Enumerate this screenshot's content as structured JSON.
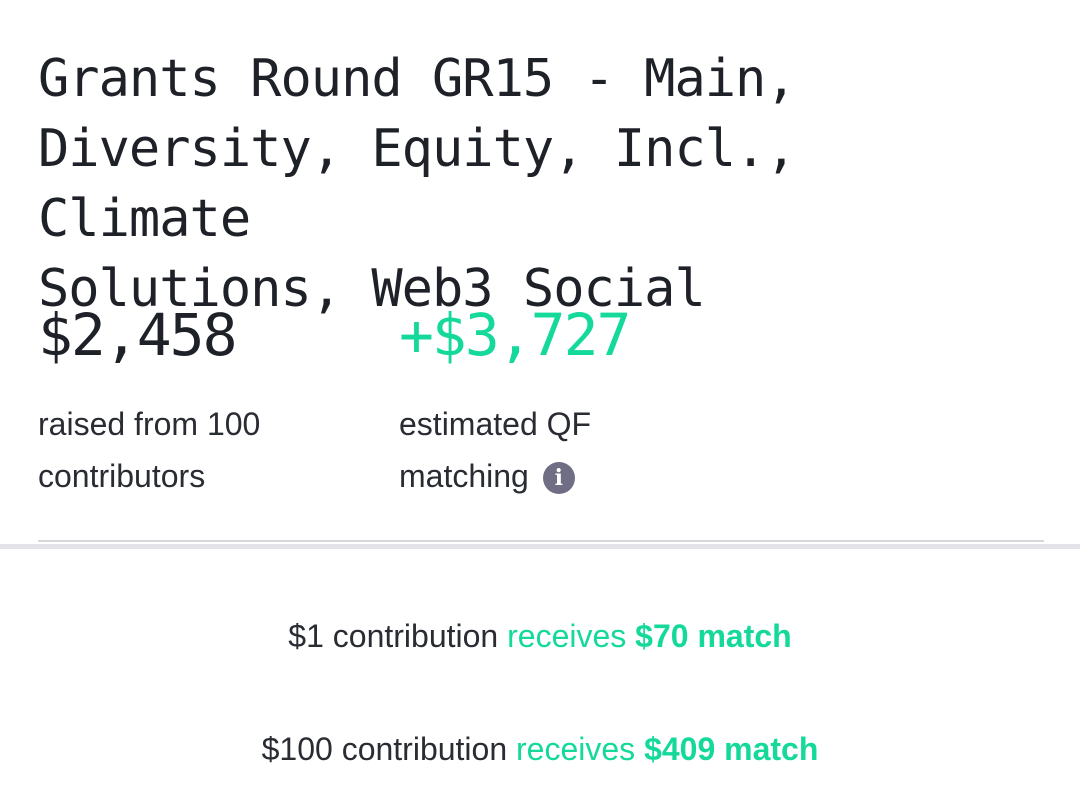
{
  "round": {
    "title_lines": [
      "Grants Round GR15 - Main,",
      "Diversity, Equity, Incl., Climate",
      "Solutions, Web3 Social"
    ]
  },
  "stats": {
    "raised_amount": "$2,458",
    "raised_caption_line1": "raised from 100",
    "raised_caption_line2": "contributors",
    "match_amount": "+$3,727",
    "match_caption_line1": "estimated QF",
    "match_caption_line2": "matching",
    "info_icon": "info-icon",
    "info_glyph": "i"
  },
  "matches": [
    {
      "amount": "$1 contribution",
      "verb": "receives",
      "match": "$70 match"
    },
    {
      "amount": "$100 contribution",
      "verb": "receives",
      "match": "$409 match"
    }
  ],
  "colors": {
    "accent_green": "#14d99a",
    "text_dark": "#1f2129",
    "info_icon_bg": "#6f6e85",
    "divider": "#e4e3ea"
  }
}
